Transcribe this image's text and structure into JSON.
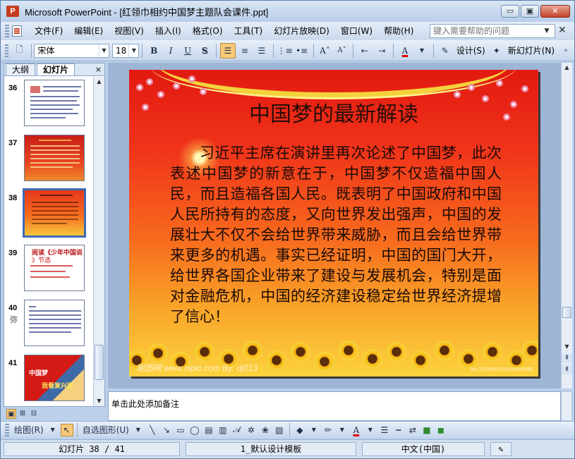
{
  "window": {
    "title": "Microsoft PowerPoint - [红领巾相约中国梦主题队会课件.ppt]",
    "app_icon_letter": "P",
    "buttons": {
      "minimize": "▭",
      "restore": "▣",
      "close": "✕"
    }
  },
  "menu": {
    "items": [
      "文件(F)",
      "编辑(E)",
      "视图(V)",
      "插入(I)",
      "格式(O)",
      "工具(T)",
      "幻灯片放映(D)",
      "窗口(W)",
      "帮助(H)"
    ],
    "help_placeholder": "键入需要帮助的问题",
    "close_glyph": "✕"
  },
  "toolbar": {
    "font_name": "宋体",
    "font_size": "18",
    "bold": "B",
    "italic": "I",
    "underline": "U",
    "shadow": "S",
    "design_label": "设计(S)",
    "new_slide_label": "新幻灯片(N)",
    "font_color": "A",
    "increase_font": "A˄",
    "decrease_font": "A˅"
  },
  "left_panel": {
    "tabs": [
      "大纲",
      "幻灯片"
    ],
    "tab_close": "×",
    "slides": [
      {
        "number": "36",
        "style": "white"
      },
      {
        "number": "37",
        "style": "red"
      },
      {
        "number": "38",
        "style": "fire",
        "selected": true
      },
      {
        "number": "39",
        "style": "white",
        "title": "阅读《少年中国说",
        "subtitle": "》节选"
      },
      {
        "number": "40",
        "style": "white",
        "extra": "弥"
      },
      {
        "number": "41",
        "style": "flag",
        "title": "中国梦",
        "subtitle": "我看复兴路"
      }
    ]
  },
  "slide": {
    "title": "中国梦的最新解读",
    "body": "习近平主席在演讲里再次论述了中国梦，此次表述中国梦的新意在于，中国梦不仅造福中国人民，而且造福各国人民。既表明了中国政府和中国人民所持有的态度，又向世界发出强声，中国的发展壮大不仅不会给世界带来威胁，而且会给世界带来更多的机遇。事实已经证明，中国的国门大开，给世界各国企业带来了建设与发展机会，特别是面对金融危机，中国的经济建设稳定给世界经济提增了信心！",
    "watermark": "昵图网 www.nipic.com  By: dj013",
    "watermark_right": "No.20130621141155658039"
  },
  "notes": {
    "placeholder": "单击此处添加备注"
  },
  "drawbar": {
    "draw_label": "绘图(R)",
    "autoshape_label": "自选图形(U)"
  },
  "status": {
    "slide_counter": "幻灯片 38 / 41",
    "template": "1_默认设计模板",
    "language": "中文(中国)"
  },
  "colors": {
    "accent_selected": "#f7c978",
    "selection_border": "#3f6bb4",
    "slide_text": "#1a0a06"
  }
}
